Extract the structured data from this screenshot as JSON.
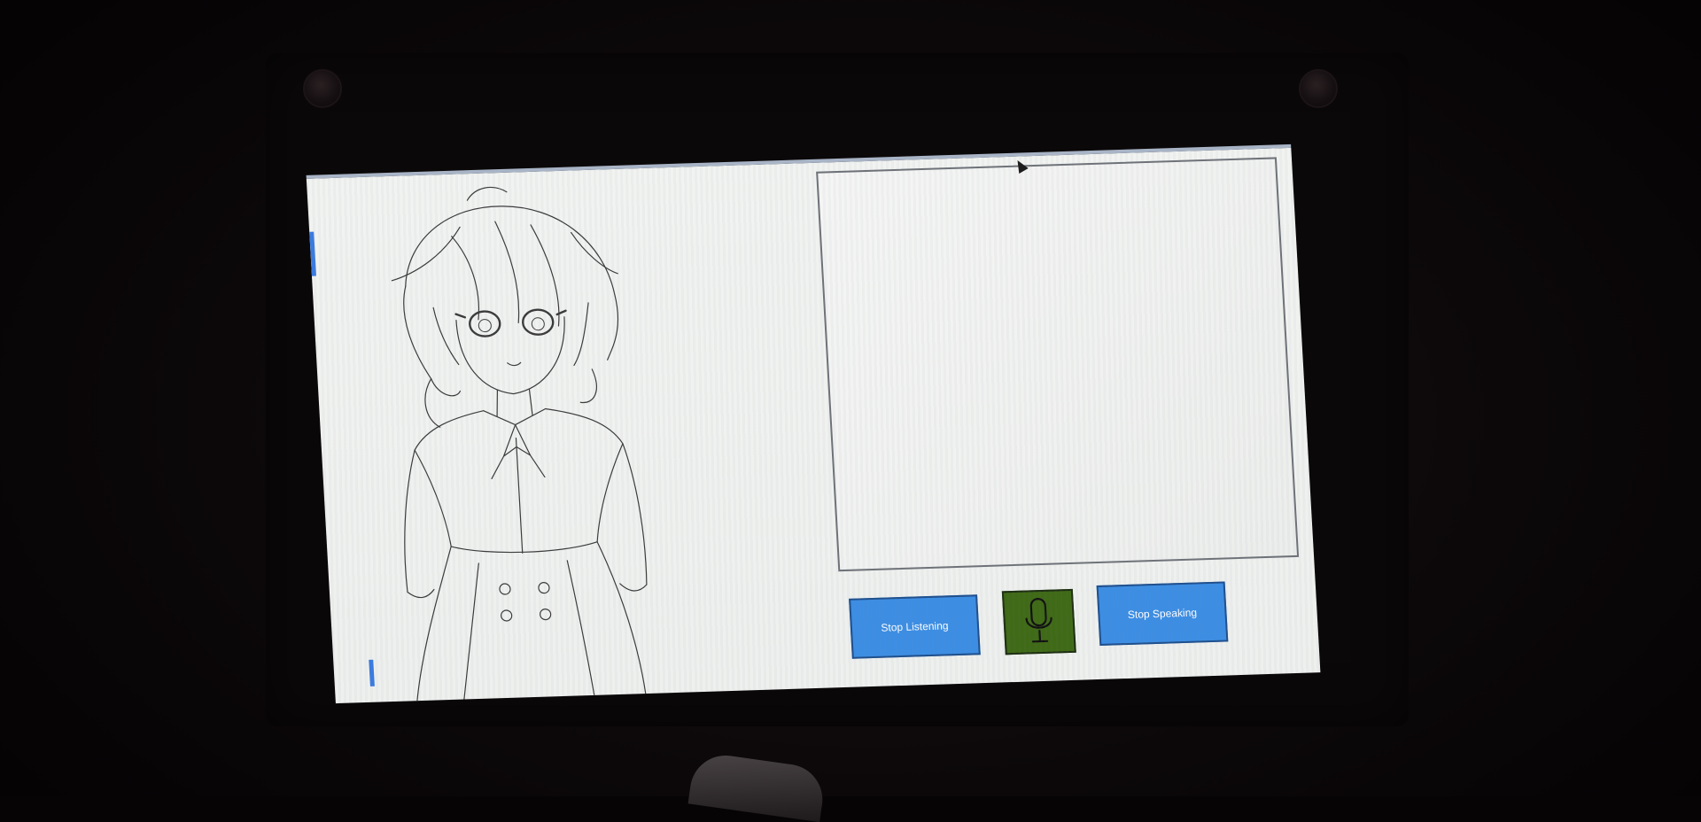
{
  "buttons": {
    "stop_listening": "Stop Listening",
    "stop_speaking": "Stop Speaking"
  },
  "icons": {
    "microphone": "microphone-icon"
  },
  "colors": {
    "button_blue": "#3c8ee4",
    "mic_green": "#3f6a16",
    "screen_bg": "#eef0ee"
  }
}
